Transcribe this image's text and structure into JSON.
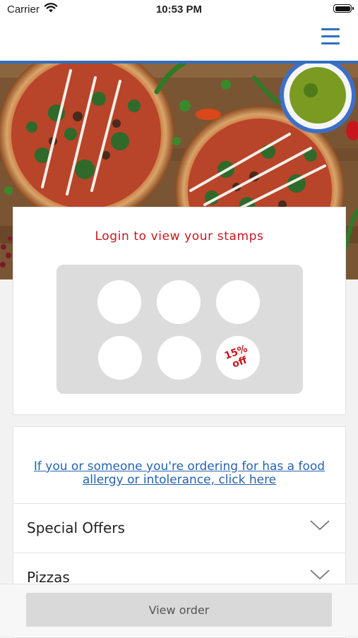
{
  "status_bar": {
    "carrier": "Carrier",
    "time": "10:53 PM"
  },
  "nav": {
    "menu_icon": "hamburger-menu-icon",
    "accent_color": "#2f6fbf"
  },
  "hero": {
    "image": "pizza-hero-image"
  },
  "stamp_card": {
    "title": "Login to view your stamps",
    "title_color": "#c8161d",
    "stamps_total": 6,
    "stamps_collected": 0,
    "reward_line1": "15%",
    "reward_line2": "off"
  },
  "menu": {
    "allergy_link": "If you or someone you're ordering for has a food allergy or intolerance, click here",
    "link_color": "#2463b0",
    "categories": [
      {
        "label": "Special Offers",
        "icon": "chevron-down-icon"
      },
      {
        "label": "Pizzas",
        "icon": "chevron-down-icon"
      }
    ]
  },
  "bottom_bar": {
    "view_order_label": "View order"
  }
}
